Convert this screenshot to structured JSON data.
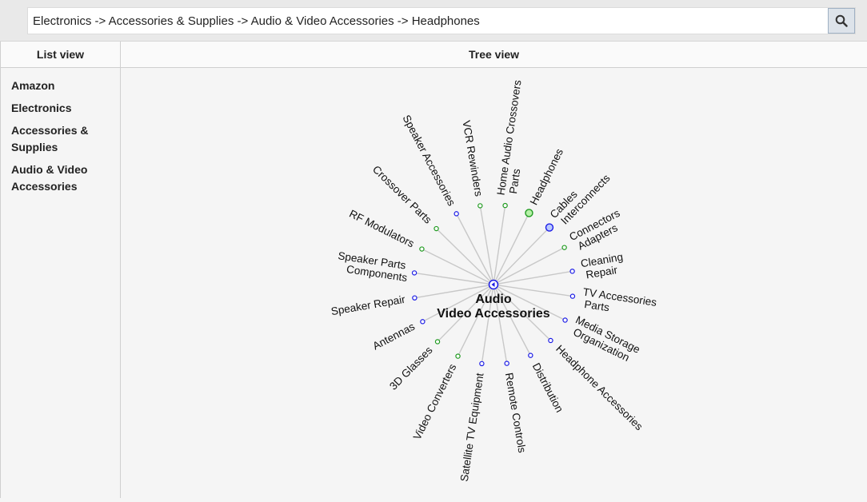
{
  "search": {
    "value": "Electronics -> Accessories & Supplies -> Audio & Video Accessories -> Headphones"
  },
  "list_view": {
    "title": "List view",
    "items": [
      "Amazon",
      "Electronics",
      "Accessories & Supplies",
      "Audio & Video Accessories"
    ]
  },
  "tree_view": {
    "title": "Tree view",
    "center": {
      "lines": [
        "Audio",
        "Video Accessories"
      ]
    },
    "nodes": [
      {
        "lines": [
          "Home Audio Crossovers",
          "Parts"
        ],
        "color": "green"
      },
      {
        "lines": [
          "Headphones"
        ],
        "color": "green",
        "highlight": true
      },
      {
        "lines": [
          "Cables",
          "Interconnects"
        ],
        "color": "blue",
        "highlight": true
      },
      {
        "lines": [
          "Connectors",
          "Adapters"
        ],
        "color": "green"
      },
      {
        "lines": [
          "Cleaning",
          "Repair"
        ],
        "color": "blue"
      },
      {
        "lines": [
          "TV Accessories",
          "Parts"
        ],
        "color": "blue"
      },
      {
        "lines": [
          "Media Storage",
          "Organization"
        ],
        "color": "blue"
      },
      {
        "lines": [
          "Headphone Accessories"
        ],
        "color": "blue"
      },
      {
        "lines": [
          "Distribution"
        ],
        "color": "blue"
      },
      {
        "lines": [
          "Remote Controls"
        ],
        "color": "blue"
      },
      {
        "lines": [
          "Satellite TV Equipment"
        ],
        "color": "blue"
      },
      {
        "lines": [
          "Video Converters"
        ],
        "color": "green"
      },
      {
        "lines": [
          "3D Glasses"
        ],
        "color": "green"
      },
      {
        "lines": [
          "Antennas"
        ],
        "color": "blue"
      },
      {
        "lines": [
          "Speaker Repair"
        ],
        "color": "blue"
      },
      {
        "lines": [
          "Speaker Parts",
          "Components"
        ],
        "color": "blue"
      },
      {
        "lines": [
          "RF Modulators"
        ],
        "color": "green"
      },
      {
        "lines": [
          "Crossover Parts"
        ],
        "color": "green"
      },
      {
        "lines": [
          "Speaker Accessories"
        ],
        "color": "blue"
      },
      {
        "lines": [
          "VCR Rewinders"
        ],
        "color": "green"
      }
    ]
  },
  "colors": {
    "blue_node": "#1c1ce6",
    "green_node": "#1f9a1f",
    "link": "#c8c8c8",
    "highlight_blue_fill": "#b9c9ff",
    "highlight_green_fill": "#b6f0a8"
  },
  "icons": {
    "search": "search-icon"
  }
}
